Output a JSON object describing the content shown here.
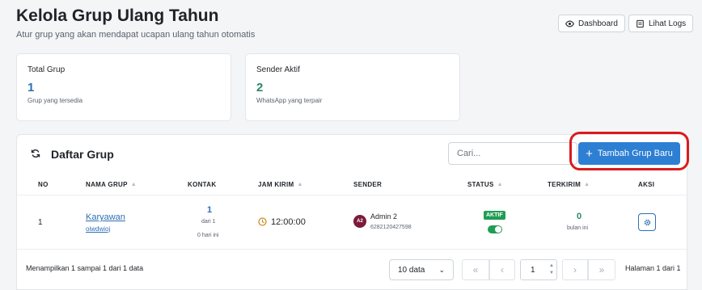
{
  "header": {
    "title": "Kelola Grup Ulang Tahun",
    "subtitle": "Atur grup yang akan mendapat ucapan ulang tahun otomatis",
    "dashboard_label": "Dashboard",
    "logs_label": "Lihat Logs"
  },
  "stats": [
    {
      "label": "Total Grup",
      "value": "1",
      "sub": "Grup yang tersedia",
      "color": "#2d6fb3"
    },
    {
      "label": "Sender Aktif",
      "value": "2",
      "sub": "WhatsApp yang terpair",
      "color": "#2a8a6e"
    }
  ],
  "panel": {
    "title": "Daftar Grup",
    "search_placeholder": "Cari...",
    "add_label": "Tambah Grup Baru"
  },
  "table": {
    "headers": {
      "no": "NO",
      "nama": "NAMA GRUP",
      "kontak": "KONTAK",
      "jam": "JAM KIRIM",
      "sender": "SENDER",
      "status": "STATUS",
      "terkirim": "TERKIRIM",
      "aksi": "AKSI"
    },
    "rows": [
      {
        "no": "1",
        "name": "Karyawan",
        "code": "oiwdwioj",
        "kontak": "1",
        "kontak_sub": "dari 1",
        "kontak_sub2": "0 hari ini",
        "jam": "12:00:00",
        "avatar": "A2",
        "sender_name": "Admin 2",
        "sender_phone": "6282120427598",
        "status": "AKTIF",
        "terkirim": "0",
        "terkirim_sub": "bulan ini"
      }
    ]
  },
  "footer": {
    "info": "Menampilkan 1 sampai 1 dari 1 data",
    "page_size": "10 data",
    "page": "1",
    "page_info": "Halaman 1 dari 1"
  }
}
